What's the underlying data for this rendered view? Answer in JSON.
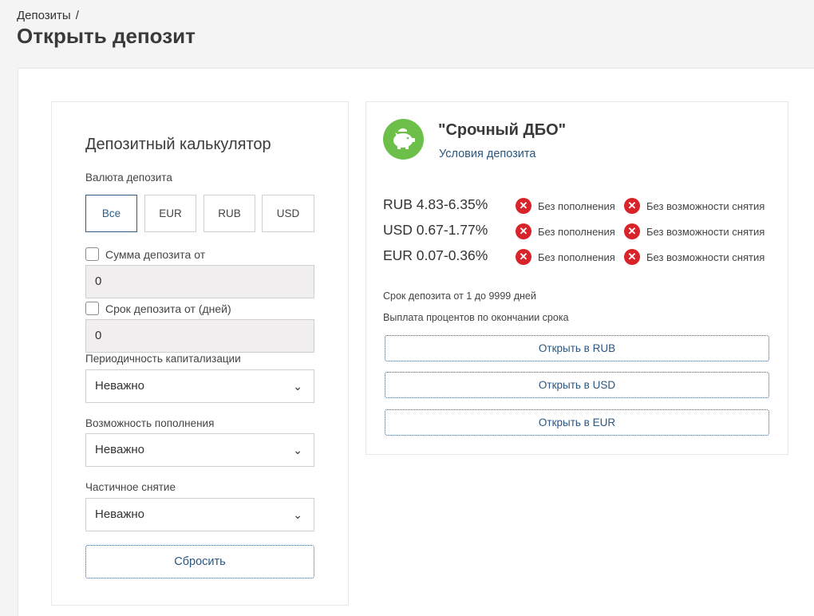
{
  "breadcrumb": {
    "item": "Депозиты",
    "separator": "/"
  },
  "page_title": "Открыть депозит",
  "calculator": {
    "title": "Депозитный калькулятор",
    "currency_label": "Валюта депозита",
    "currencies": [
      "Все",
      "EUR",
      "RUB",
      "USD"
    ],
    "amount_checkbox": "Сумма депозита от",
    "amount_value": "0",
    "term_checkbox": "Срок депозита от (дней)",
    "term_value": "0",
    "capitalization_label": "Периодичность капитализации",
    "capitalization_value": "Неважно",
    "replenishment_label": "Возможность пополнения",
    "replenishment_value": "Неважно",
    "withdrawal_label": "Частичное снятие",
    "withdrawal_value": "Неважно",
    "reset_label": "Сбросить"
  },
  "product": {
    "name": "\"Срочный ДБО\"",
    "terms_link": "Условия депозита",
    "rates": [
      {
        "rate": "RUB 4.83-6.35%",
        "no_topup": "Без пополнения",
        "no_withdraw": "Без возможности снятия"
      },
      {
        "rate": "USD 0.67-1.77%",
        "no_topup": "Без пополнения",
        "no_withdraw": "Без возможности снятия"
      },
      {
        "rate": "EUR 0.07-0.36%",
        "no_topup": "Без пополнения",
        "no_withdraw": "Без возможности снятия"
      }
    ],
    "term_info": "Срок депозита от 1 до 9999 дней",
    "payout_info": "Выплата процентов по окончании срока",
    "open_buttons": [
      "Открыть в RUB",
      "Открыть в USD",
      "Открыть в EUR"
    ]
  },
  "icons": {
    "logo": "piggy-bank-icon",
    "badge": "cross-circle-icon",
    "select": "chevron-down-icon"
  },
  "colors": {
    "accent": "#2a5680",
    "logo_green": "#6cc04a",
    "error_red": "#d8232a"
  }
}
